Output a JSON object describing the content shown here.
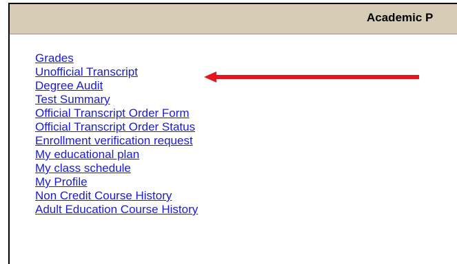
{
  "header": {
    "title": "Academic P"
  },
  "links": [
    "Grades",
    "Unofficial Transcript",
    "Degree Audit",
    "Test Summary",
    "Official Transcript Order Form",
    "Official Transcript Order Status",
    "Enrollment verification request",
    "My educational plan",
    "My class schedule",
    "My Profile",
    "Non Credit Course History",
    "Adult Education Course History"
  ],
  "annotation": {
    "arrow_color": "#e8141b",
    "points_to": "Unofficial Transcript"
  }
}
